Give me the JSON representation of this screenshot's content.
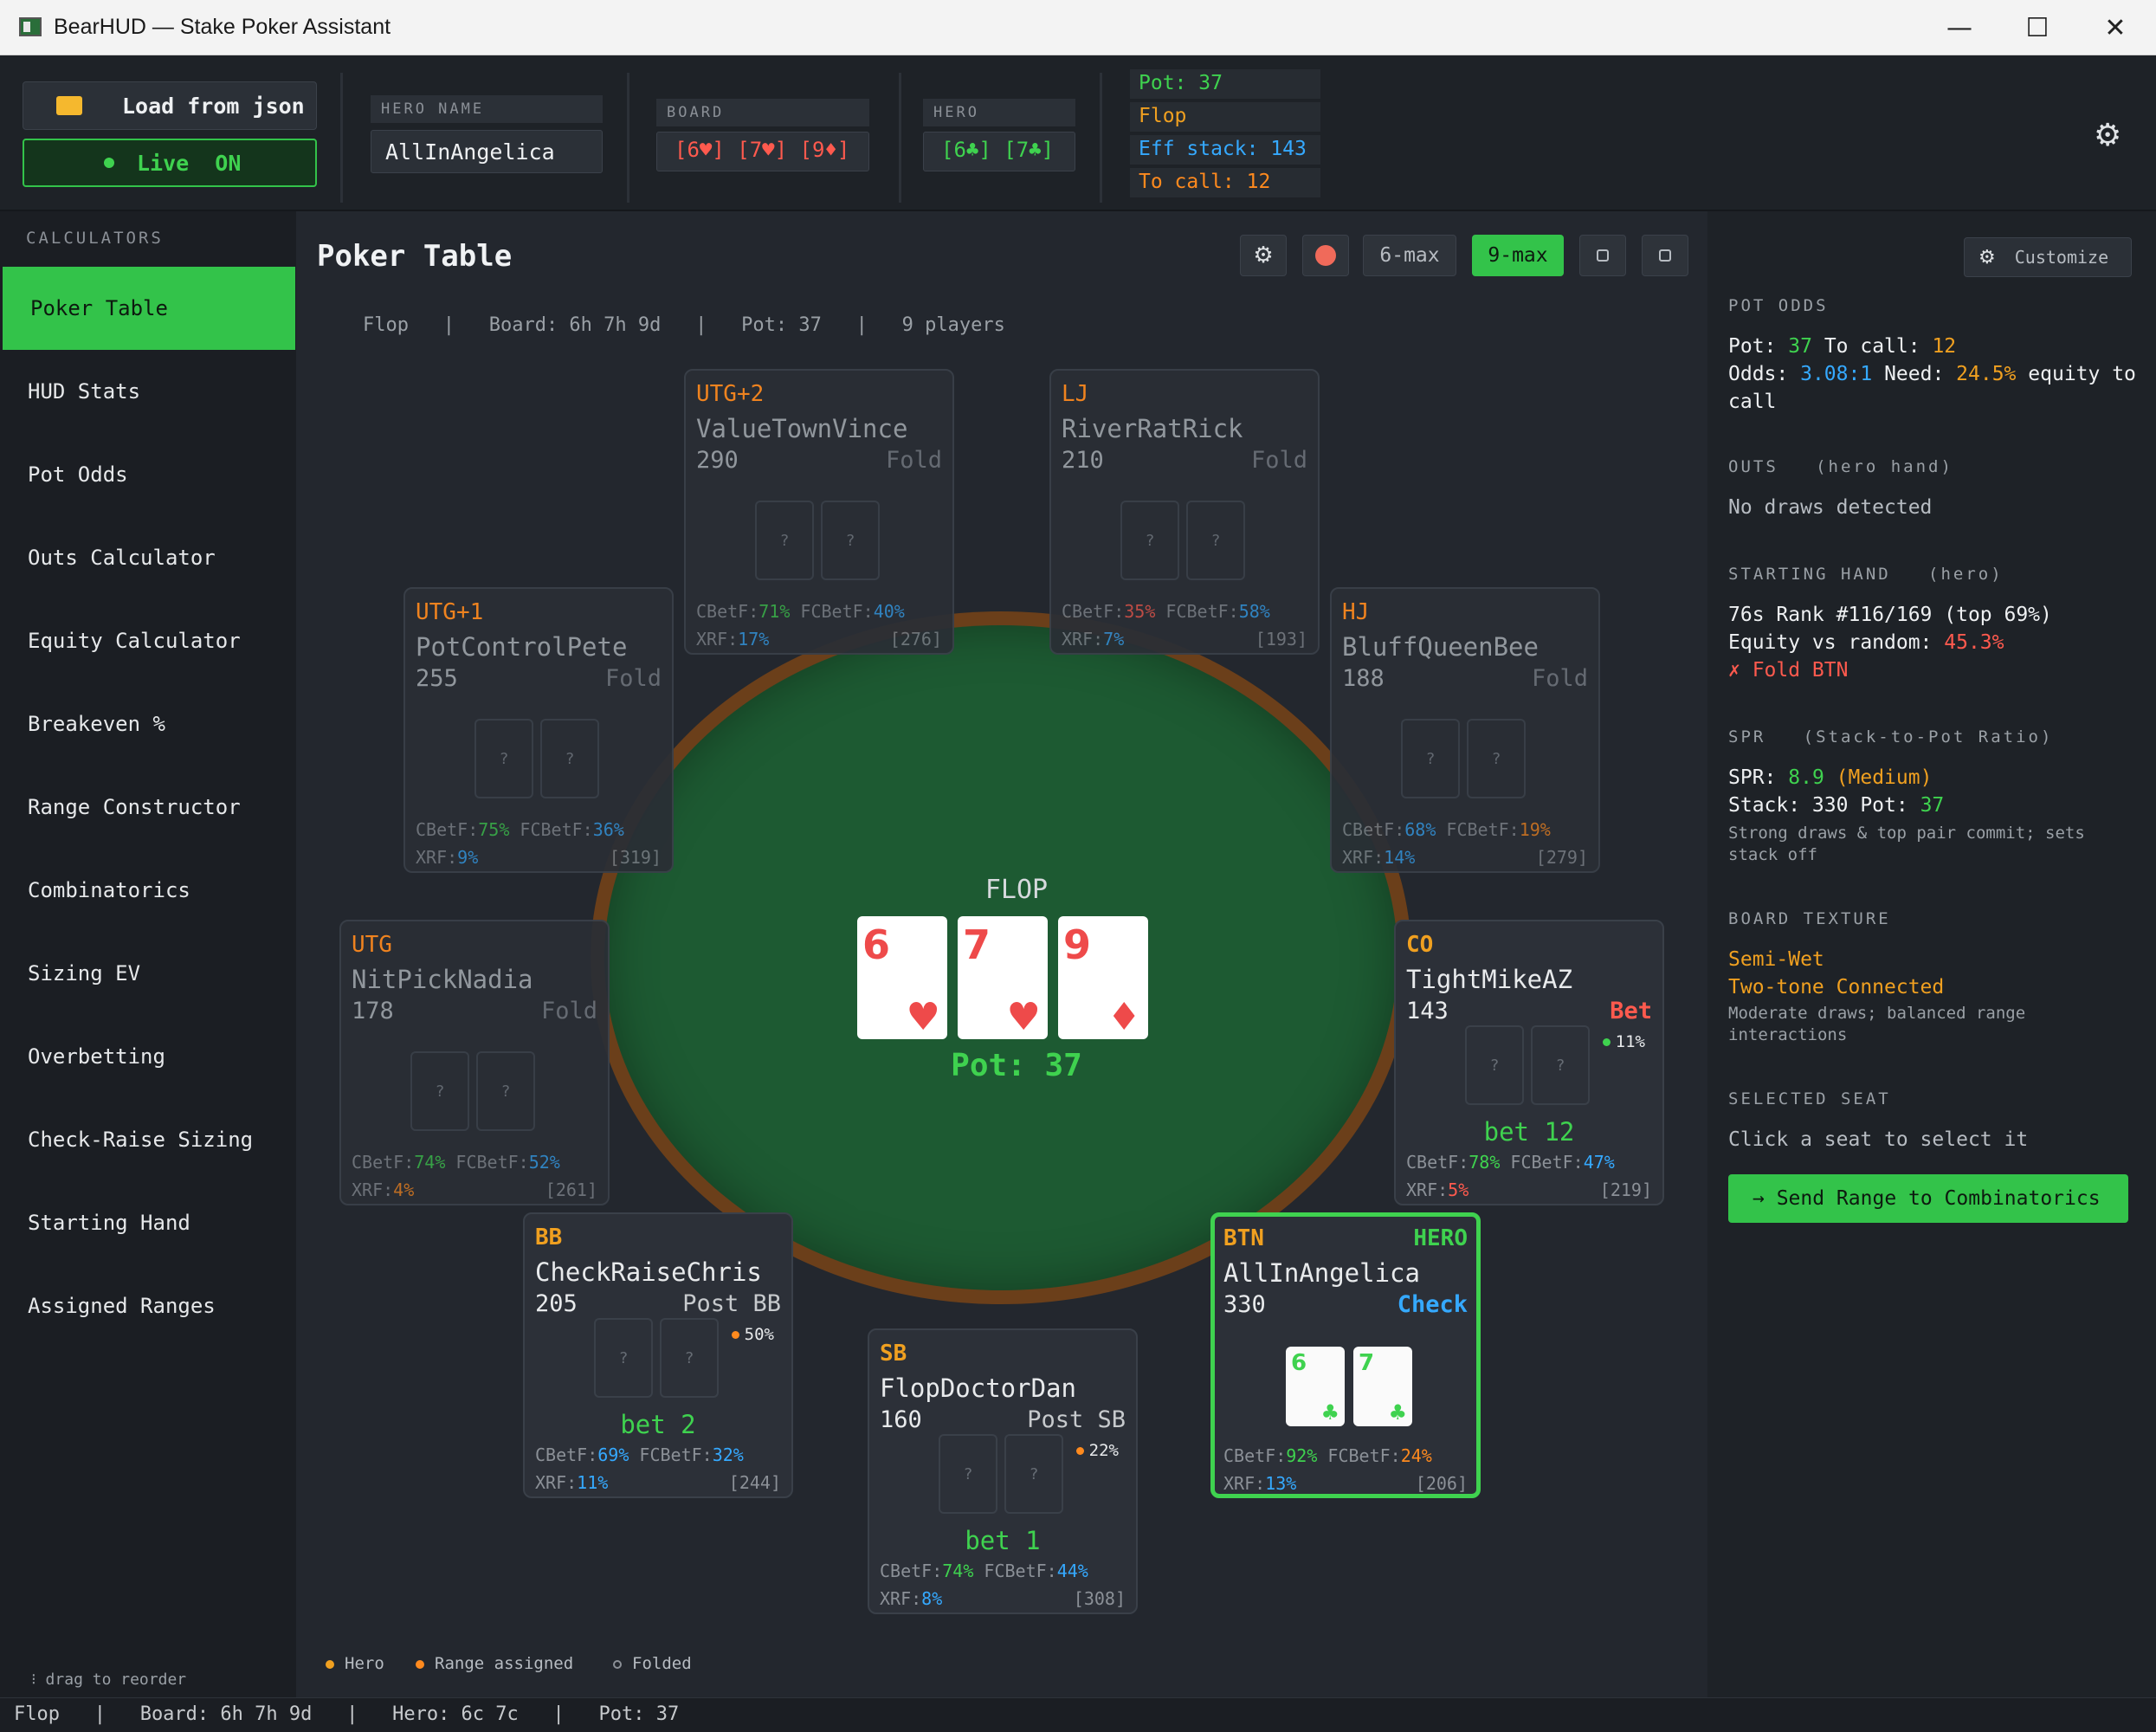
{
  "window": {
    "title": "BearHUD — Stake Poker Assistant",
    "minimize": "—",
    "maximize": "☐",
    "close": "✕"
  },
  "topbar": {
    "load_button": "Load from json",
    "live_button": "Live  ON",
    "hero_name_label": "HERO NAME",
    "hero_name_value": "AllInAngelica",
    "board_label": "BOARD",
    "board_cards": "[6♥] [7♥] [9♦]",
    "hero_label": "HERO",
    "hero_cards": "[6♣] [7♣]",
    "pot": "Pot: 37",
    "street": "Flop",
    "eff_stack": "Eff stack: 143",
    "to_call": "To call: 12"
  },
  "sidebar": {
    "caption": "CALCULATORS",
    "items": [
      "Poker Table",
      "HUD Stats",
      "Pot Odds",
      "Outs Calculator",
      "Equity Calculator",
      "Breakeven %",
      "Range Constructor",
      "Combinatorics",
      "Sizing EV",
      "Overbetting",
      "Check-Raise Sizing",
      "Starting Hand",
      "Assigned Ranges"
    ],
    "drag_hint": "⁝ drag to reorder"
  },
  "main": {
    "title": "Poker Table",
    "subtitle": {
      "street": "Flop",
      "board": "Board: 6h 7h 9d",
      "pot": "Pot: 37",
      "players": "9 players",
      "sep": "|"
    },
    "toolbar": {
      "six_max": "6-max",
      "nine_max": "9-max"
    },
    "table": {
      "street_label": "FLOP",
      "pot_label": "Pot: 37",
      "board": [
        {
          "rank": "6",
          "suit": "♥"
        },
        {
          "rank": "7",
          "suit": "♥"
        },
        {
          "rank": "9",
          "suit": "♦"
        }
      ]
    },
    "legend": {
      "hero": "Hero",
      "range": "Range assigned",
      "folded": "Folded"
    }
  },
  "seats": {
    "utg2": {
      "pos": "UTG+2",
      "name": "ValueTownVince",
      "stack": "290",
      "action": "Fold",
      "cbetf": "71%",
      "fcbetf": "40%",
      "xrf": "17%",
      "vp": "[276]"
    },
    "lj": {
      "pos": "LJ",
      "name": "RiverRatRick",
      "stack": "210",
      "action": "Fold",
      "cbetf": "35%",
      "fcbetf": "58%",
      "xrf": "7%",
      "vp": "[193]"
    },
    "utg1": {
      "pos": "UTG+1",
      "name": "PotControlPete",
      "stack": "255",
      "action": "Fold",
      "cbetf": "75%",
      "fcbetf": "36%",
      "xrf": "9%",
      "vp": "[319]"
    },
    "hj": {
      "pos": "HJ",
      "name": "BluffQueenBee",
      "stack": "188",
      "action": "Fold",
      "cbetf": "68%",
      "fcbetf": "19%",
      "xrf": "14%",
      "vp": "[279]"
    },
    "utg": {
      "pos": "UTG",
      "name": "NitPickNadia",
      "stack": "178",
      "action": "Fold",
      "cbetf": "74%",
      "fcbetf": "52%",
      "xrf": "4%",
      "vp": "[261]"
    },
    "co": {
      "pos": "CO",
      "name": "TightMikeAZ",
      "stack": "143",
      "action": "Bet",
      "pct": "11%",
      "bet": "bet 12",
      "cbetf": "78%",
      "fcbetf": "47%",
      "xrf": "5%",
      "vp": "[219]"
    },
    "bb": {
      "pos": "BB",
      "name": "CheckRaiseChris",
      "stack": "205",
      "action": "Post BB",
      "pct": "50%",
      "bet": "bet 2",
      "cbetf": "69%",
      "fcbetf": "32%",
      "xrf": "11%",
      "vp": "[244]"
    },
    "sb": {
      "pos": "SB",
      "name": "FlopDoctorDan",
      "stack": "160",
      "action": "Post SB",
      "pct": "22%",
      "bet": "bet 1",
      "cbetf": "74%",
      "fcbetf": "44%",
      "xrf": "8%",
      "vp": "[308]"
    },
    "btn": {
      "pos": "BTN",
      "tag": "HERO",
      "name": "AllInAngelica",
      "stack": "330",
      "action": "Check",
      "cards": [
        {
          "rank": "6",
          "suit": "♣"
        },
        {
          "rank": "7",
          "suit": "♣"
        }
      ],
      "cbetf": "92%",
      "fcbetf": "24%",
      "xrf": "13%",
      "vp": "[206]"
    },
    "hidden_card": "?",
    "labels": {
      "cbetf": "CBetF:",
      "fcbetf": "FCBetF:",
      "xrf": "XRF:"
    }
  },
  "right_panel": {
    "customize": "Customize",
    "pot_odds": {
      "heading": "POT ODDS",
      "pot_label": "Pot:",
      "pot": "37",
      "call_label": "To call:",
      "call": "12",
      "odds_label": "Odds:",
      "odds": "3.08:1",
      "need_label": "Need:",
      "need": "24.5%",
      "need_tail": "equity to call"
    },
    "outs": {
      "heading": "OUTS   (hero hand)",
      "text": "No draws detected"
    },
    "starting_hand": {
      "heading": "STARTING HAND   (hero)",
      "line1": "76s Rank #116/169 (top 69%)",
      "eq_label": "Equity vs random:",
      "eq": "45.3%",
      "advice": "✗ Fold BTN"
    },
    "spr": {
      "heading": "SPR   (Stack-to-Pot Ratio)",
      "spr_label": "SPR:",
      "spr": "8.9",
      "spr_tag": "(Medium)",
      "stack_label": "Stack: 330 Pot:",
      "stack_pot": "37",
      "note": "Strong draws & top pair commit; sets stack off"
    },
    "texture": {
      "heading": "BOARD TEXTURE",
      "line1": "Semi-Wet",
      "line2": "Two-tone Connected",
      "note": "Moderate draws; balanced range interactions"
    },
    "selected": {
      "heading": "SELECTED SEAT",
      "text": "Click a seat to select it"
    },
    "send_button": "→ Send Range to Combinatorics"
  },
  "statusbar": "Flop   |   Board: 6h 7h 9d   |   Hero: 6c 7c   |   Pot: 37",
  "colors": {
    "accent_green": "#3fd24f",
    "blue": "#35a9ff",
    "orange": "#ff8a1e",
    "red": "#ff5a4e",
    "felt": "#1d5a32",
    "rail": "#6b3f1a"
  }
}
